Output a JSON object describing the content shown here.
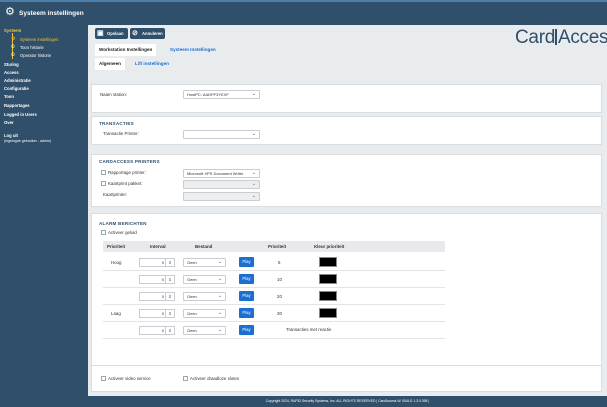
{
  "app": {
    "title": "Systeem instellingen",
    "icon": "gear-icon"
  },
  "sidebar": {
    "systeem": "Systeem",
    "systeem_instellingen": "Systeem instellingen",
    "toon_historie": "Toon historie",
    "operator_historie": "Operator historie",
    "items": [
      "Sturing",
      "Access",
      "Administratie",
      "Configuratie",
      "Toon",
      "Rapportages"
    ],
    "logged_in": "Logged in Users",
    "over": "Over",
    "log_uit": "Log uit",
    "log_uit_sub": "(ingelogde gebruiker - admin)"
  },
  "logo": {
    "left": "Card",
    "right": "Access"
  },
  "toolbar": {
    "save_label": "Opslaan",
    "cancel_label": "Annuleren"
  },
  "tabs": {
    "workstation": "Workstation Instellingen",
    "systeem": "Systeem Instellingen"
  },
  "subtabs": {
    "algemeen": "Algemeen",
    "lift": "Lift instellingen"
  },
  "station": {
    "label": "Naam station:",
    "value": "HostPC: AADPF3YEXF"
  },
  "transacties": {
    "title": "TRANSACTIES",
    "printer_label": "Transactie Printer:",
    "printer_value": ""
  },
  "printers": {
    "title": "CARDACCESS PRINTERS",
    "rapportage_label": "Rapportage printer:",
    "rapportage_value": "Microsoft XPS Document Writer",
    "kaartprint_label": "Kaartprint pakket:",
    "kaartprinter_label": "Kaartprinter:"
  },
  "alarm": {
    "title": "ALARM BERICHTEN",
    "activeer_geluid": "Activeer geluid",
    "headers": [
      "Prioriteit",
      "Interval",
      "Bestand",
      "Prioriteit",
      "Kleur prioriteit"
    ],
    "rows": [
      {
        "prio_label": "Hoog",
        "interval": "0",
        "bestand": "Geen",
        "play": "Play",
        "prio": "5",
        "color": "#000000"
      },
      {
        "prio_label": "",
        "interval": "0",
        "bestand": "Geen",
        "play": "Play",
        "prio": "10",
        "color": "#000000"
      },
      {
        "prio_label": "",
        "interval": "0",
        "bestand": "Geen",
        "play": "Play",
        "prio": "20",
        "color": "#000000"
      },
      {
        "prio_label": "Laag",
        "interval": "0",
        "bestand": "Geen",
        "play": "Play",
        "prio": "30",
        "color": "#000000"
      },
      {
        "prio_label": "",
        "interval": "0",
        "bestand": "Geen",
        "play": "Play",
        "prio": "Transacties met reactie",
        "color": ""
      }
    ]
  },
  "bottom": {
    "video": "Activeer video service",
    "draadloze": "Activeer draadloze sloten"
  },
  "footer": "Copyright 2024, RAPID Security Systems, Inc. ALL RIGHTS RESERVED | CardAccess W. BUILD 1.3.0.398 |"
}
